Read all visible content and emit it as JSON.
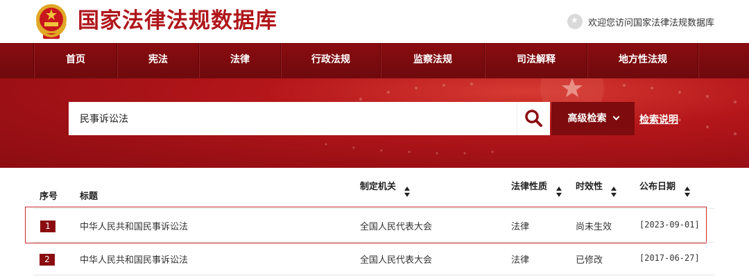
{
  "header": {
    "site_title": "国家法律法规数据库",
    "welcome_text": "欢迎您访问国家法律法规数据库"
  },
  "nav": {
    "items": [
      "首页",
      "宪法",
      "法律",
      "行政法规",
      "监察法规",
      "司法解释",
      "地方性法规"
    ]
  },
  "search": {
    "value": "民事诉讼法",
    "advanced_label": "高级检索",
    "help_label": "检索说明"
  },
  "table": {
    "headers": {
      "index": "序号",
      "title": "标题",
      "authority": "制定机关",
      "nature": "法律性质",
      "validity": "时效性",
      "date": "公布日期"
    },
    "rows": [
      {
        "index": "1",
        "title": "中华人民共和国民事诉讼法",
        "authority": "全国人民代表大会",
        "nature": "法律",
        "validity": "尚未生效",
        "date": "[2023-09-01]"
      },
      {
        "index": "2",
        "title": "中华人民共和国民事诉讼法",
        "authority": "全国人民代表大会",
        "nature": "法律",
        "validity": "已修改",
        "date": "[2017-06-27]"
      }
    ]
  },
  "colors": {
    "brand_red": "#b0161b",
    "nav_dark_red": "#7e0b0e"
  }
}
